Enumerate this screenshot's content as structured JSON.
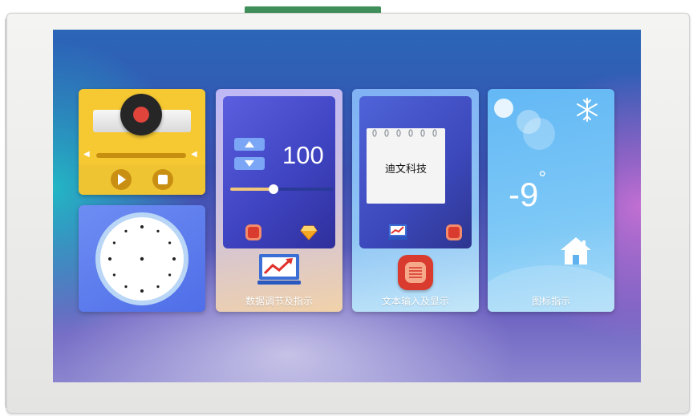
{
  "tiles": {
    "music": {},
    "clock": {},
    "data_adjust": {
      "value": "100",
      "slider_level": 0.42,
      "caption": "数据调节及指示"
    },
    "text_input": {
      "note_text": "迪文科技",
      "caption": "文本输入及显示"
    },
    "icon_indicator": {
      "temperature": "-9",
      "degree": "°",
      "caption": "图标指示"
    }
  },
  "colors": {
    "music_tile": "#f6c933",
    "clock_tile": "#5d7cf0",
    "accent_red": "#d93b2e",
    "gold": "#f0c679"
  }
}
